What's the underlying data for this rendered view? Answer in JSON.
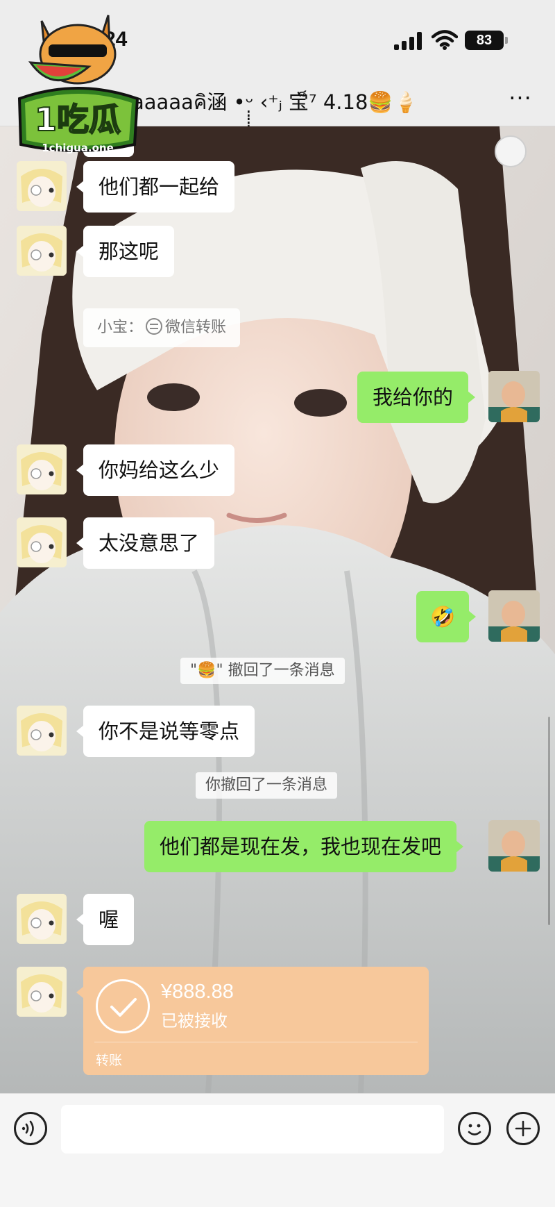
{
  "status_bar": {
    "time": "24",
    "battery": "83"
  },
  "header": {
    "title": "aaaaaคิ涵 •ᵕ̣̣̣̣̣ ‹⁺ⱼ 宝็⁷ 4.18🍔🍦",
    "more_label": "···"
  },
  "logo": {
    "text": "1吃瓜",
    "domain": "1chigua.one"
  },
  "messages": {
    "m_top": "道",
    "m1": "他们都一起给",
    "m2": "那这呢",
    "quote_sender": "小宝：",
    "quote_text": "微信转账",
    "m3": "我给你的",
    "m4": "你妈给这么少",
    "m5": "太没意思了",
    "m6": "🤣",
    "sys1": "\"🍔\" 撤回了一条消息",
    "m7": "你不是说等零点",
    "sys2": "你撤回了一条消息",
    "m8": "他们都是现在发，我也现在发吧",
    "m9": "喔"
  },
  "transfer": {
    "amount": "¥888.88",
    "status": "已被接收",
    "label": "转账"
  },
  "input_bar": {
    "placeholder": ""
  },
  "colors": {
    "outgoing": "#95ec69",
    "incoming": "#ffffff",
    "transfer": "#f7c89b"
  }
}
